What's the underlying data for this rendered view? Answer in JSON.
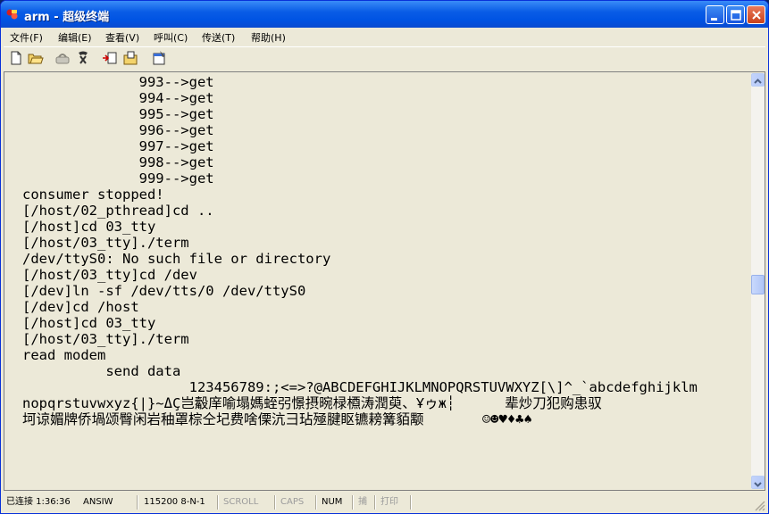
{
  "window": {
    "title": "arm - 超级终端"
  },
  "menu": {
    "items": [
      {
        "label": "文件(F)"
      },
      {
        "label": "编辑(E)"
      },
      {
        "label": "查看(V)"
      },
      {
        "label": "呼叫(C)"
      },
      {
        "label": "传送(T)"
      },
      {
        "label": "帮助(H)"
      }
    ]
  },
  "toolbar": {
    "icons": [
      "new-icon",
      "open-icon",
      "disconnect-icon",
      "dial-icon",
      "send-icon",
      "receive-icon",
      "properties-icon"
    ]
  },
  "terminal": {
    "lines": [
      "              993-->get",
      "              994-->get",
      "              995-->get",
      "              996-->get",
      "              997-->get",
      "              998-->get",
      "              999-->get",
      "consumer stopped!",
      "[/host/02_pthread]cd ..",
      "[/host]cd 03_tty",
      "[/host/03_tty]./term",
      "/dev/ttyS0: No such file or directory",
      "[/host/03_tty]cd /dev",
      "[/dev]ln -sf /dev/tts/0 /dev/ttyS0",
      "[/dev]cd /host",
      "[/host]cd 03_tty",
      "[/host/03_tty]./term",
      "read modem",
      "          send data",
      "                    123456789:;<=>?@ABCDEFGHIJKLMNOPQRSTUVWXYZ[\\]^_`abcdefghijklm",
      "nopqrstuvwxyz{|}~ΔÇ岂觳庠喻塌媽蛭弜憬摂晼椂槱涛潤萸、Ұゥж┆      辈炒刀犯购患驭",
      "坷谅媚牌侨堝颂臀闲岩秞罩棕仝圮费啥傈沆彐玷殛腱眍镳耪篝貊颙       ☺☻♥♦♣♠"
    ]
  },
  "status": {
    "connected": "已连接 1:36:36",
    "emulation": "ANSIW",
    "baud": "115200 8-N-1",
    "scroll": "SCROLL",
    "caps": "CAPS",
    "num": "NUM",
    "capture": "捕",
    "print": "打印"
  },
  "colors": {
    "titlebar": "#0054e3",
    "chrome": "#ece9d8",
    "text": "#000000"
  }
}
